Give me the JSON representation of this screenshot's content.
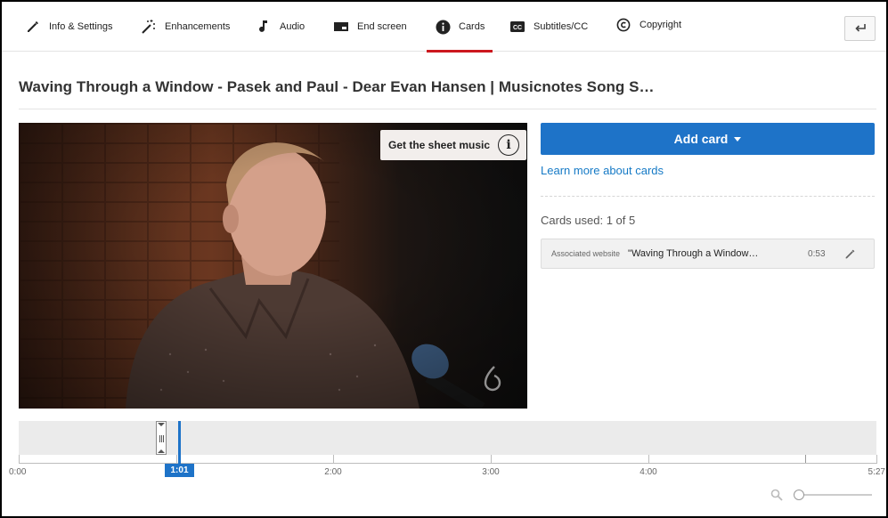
{
  "tabs": [
    {
      "label": "Info & Settings",
      "icon": "pencil-icon"
    },
    {
      "label": "Enhancements",
      "icon": "magic-wand-icon"
    },
    {
      "label": "Audio",
      "icon": "music-note-icon"
    },
    {
      "label": "End screen",
      "icon": "end-screen-icon"
    },
    {
      "label": "Cards",
      "icon": "info-icon",
      "active": true
    },
    {
      "label": "Subtitles/CC",
      "icon": "closed-captions-icon"
    },
    {
      "label": "Copyright",
      "icon": "copyright-icon"
    }
  ],
  "header": {
    "back_icon": "back-arrow-icon"
  },
  "video": {
    "title": "Waving Through a Window - Pasek and Paul - Dear Evan Hansen | Musicnotes Song S…",
    "card_teaser": "Get the sheet music",
    "teaser_icon": "info-i",
    "watermark_icon": "musicnotes-logo-icon"
  },
  "panel": {
    "add_card_label": "Add card",
    "learn_more": "Learn more about cards",
    "cards_used": "Cards used: 1 of 5",
    "cards": [
      {
        "type": "Associated website",
        "title": "\"Waving Through a Window…",
        "time": "0:53"
      }
    ]
  },
  "timeline": {
    "playhead_time": "1:01",
    "ticks": [
      "0:00",
      "1:00",
      "2:00",
      "3:00",
      "4:00",
      "5:27"
    ],
    "tick_labels_shown": [
      "0:00",
      "2:00",
      "3:00",
      "4:00",
      "5:27"
    ],
    "duration_seconds": 327,
    "playhead_seconds": 61,
    "card_marker_seconds": 53
  },
  "colors": {
    "accent": "#1e73c8",
    "tab_underline": "#cc181e",
    "link": "#167ac6"
  }
}
